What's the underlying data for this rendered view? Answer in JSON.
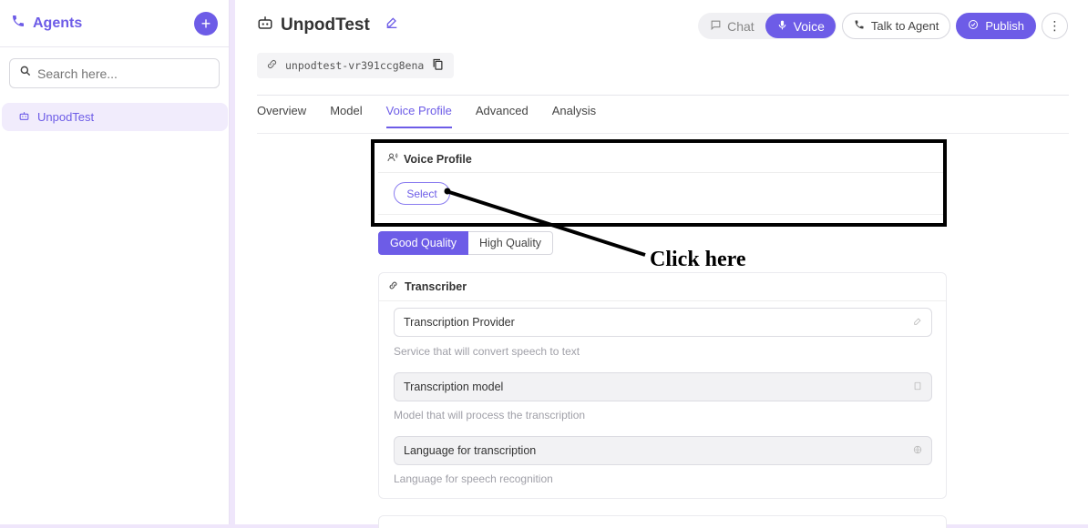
{
  "sidebar": {
    "title": "Agents",
    "add_label": "+",
    "search": {
      "placeholder": "Search here..."
    },
    "items": [
      {
        "label": "UnpodTest"
      }
    ]
  },
  "agent": {
    "name": "UnpodTest",
    "id": "unpodtest-vr391ccg8ena"
  },
  "actions": {
    "chat": "Chat",
    "voice": "Voice",
    "talk": "Talk to Agent",
    "publish": "Publish",
    "more": "⋮"
  },
  "tabs": [
    "Overview",
    "Model",
    "Voice Profile",
    "Advanced",
    "Analysis"
  ],
  "voice_profile": {
    "title": "Voice Profile",
    "select_label": "Select"
  },
  "quality": {
    "good": "Good Quality",
    "high": "High Quality"
  },
  "annotation": {
    "text": "Click here"
  },
  "transcriber": {
    "title": "Transcriber",
    "fields": [
      {
        "label": "Transcription Provider",
        "hint": "Service that will convert speech to text"
      },
      {
        "label": "Transcription model",
        "hint": "Model that will process the transcription"
      },
      {
        "label": "Language for transcription",
        "hint": "Language for speech recognition"
      }
    ]
  },
  "colors": {
    "accent": "#6d5ce7",
    "annotation": "#000000"
  }
}
